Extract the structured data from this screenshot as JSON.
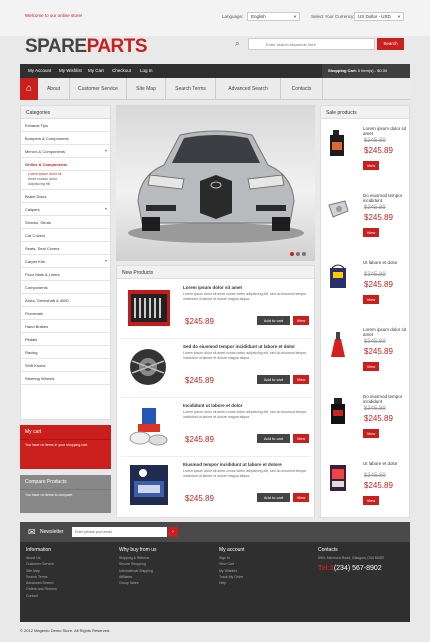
{
  "topbar": {
    "welcome": "Welcome to our online store!",
    "language_label": "Language:",
    "language_value": "English",
    "currency_label": "Select Your Currency:",
    "currency_value": "US Dollar - USD"
  },
  "logo": {
    "part1": "SPARE",
    "part2": "PARTS"
  },
  "search": {
    "placeholder": "Enter search keywords here",
    "button": "Search"
  },
  "utility": {
    "links": [
      "My Account",
      "My Wishlist",
      "My Cart",
      "Checkout",
      "Log In"
    ],
    "cart_label": "Shopping Cart:",
    "cart_value": "0 item(s) - $0.00"
  },
  "nav": {
    "items": [
      "About",
      "Customer Service",
      "Site Map",
      "Search Terms",
      "Advanced Search",
      "Contacts"
    ]
  },
  "categories": {
    "title": "Categories",
    "items": [
      "Exhaust Tips",
      "Bumpers & Components",
      "Mirrors & Components",
      "Grilles & Components",
      "Brake Discs",
      "Calipers",
      "Shocks, Struts",
      "Car Covers",
      "Seats, Seat Covers",
      "Carpet Kits",
      "Floor Mats & Liners",
      "Components",
      "Axles, Driveshaft & 4WD",
      "Floormats",
      "Hand Brakes",
      "Pedals",
      "Racing",
      "Shift Knobs",
      "Steering Wheels"
    ],
    "active_index": 3,
    "subitems": [
      "Lorem ipsum dolor sit",
      "Amet consec dolor",
      "Adipisicing elit"
    ],
    "sub_active_index": 0
  },
  "mycart": {
    "title": "My cart",
    "message": "You have no items in your shopping cart."
  },
  "compare": {
    "title": "Compare Products",
    "message": "You have no items to compare."
  },
  "new_products": {
    "title": "New Products",
    "items": [
      {
        "title": "Lorem ipsum dolor sit amet",
        "desc": "Lorem ipsum dolor sit amet conse ctetur adipisicing elit, sed do eiusmod tempor incididunt ut labore et dolore magna aliqua.",
        "price": "$245.89",
        "add": "Add to cart",
        "view": "View"
      },
      {
        "title": "Sed do eiusmod tempor incididunt ut labore et dolor",
        "desc": "Lorem ipsum dolor sit amet conse ctetur adipisicing elit, sed do eiusmod tempor incididunt ut labore et dolore magna aliqua.",
        "price": "$245.89",
        "add": "Add to cart",
        "view": "View"
      },
      {
        "title": "Incididunt ut labore et dolor",
        "desc": "Lorem ipsum dolor sit amet conse ctetur adipisicing elit, sed do eiusmod tempor incididunt ut labore et dolore magna aliqua.",
        "price": "$245.89",
        "add": "Add to cart",
        "view": "View"
      },
      {
        "title": "Eiusmod tempor incididunt ut labore et dolore",
        "desc": "Lorem ipsum dolor sit amet conse ctetur adipisicing elit, sed do eiusmod tempor incididunt ut labore et dolore magna aliqua.",
        "price": "$245.89",
        "add": "Add to cart",
        "view": "View"
      }
    ]
  },
  "sale_products": {
    "title": "Sale products",
    "items": [
      {
        "title": "Lorem ipsum dolor sit amet",
        "old": "$345.89",
        "new": "$245.89",
        "view": "View"
      },
      {
        "title": "Do eiusmod tempor incididunt",
        "old": "$345.89",
        "new": "$245.89",
        "view": "View"
      },
      {
        "title": "Ut labore et dolor",
        "old": "$345.89",
        "new": "$245.89",
        "view": "View"
      },
      {
        "title": "Lorem ipsum dolor sit amet",
        "old": "$345.89",
        "new": "$245.89",
        "view": "View"
      },
      {
        "title": "Do eiusmod tempor incididunt",
        "old": "$345.89",
        "new": "$245.89",
        "view": "View"
      },
      {
        "title": "Ut labore et dolor",
        "old": "$345.89",
        "new": "$245.89",
        "view": "View"
      }
    ]
  },
  "newsletter": {
    "label": "Newsletter",
    "placeholder": "Enter please your email"
  },
  "footer": {
    "information": {
      "title": "Information",
      "links": [
        "About Us",
        "Customer Service",
        "Site Map",
        "Search Terms",
        "Advanced Search",
        "Orders and Returns",
        "Contact"
      ]
    },
    "why": {
      "title": "Why buy from us",
      "links": [
        "Shipping & Returns",
        "Secure Shopping",
        "International Shipping",
        "Affiliates",
        "Group Sales"
      ]
    },
    "account": {
      "title": "My account",
      "links": [
        "Sign In",
        "View Cart",
        "My Wishlist",
        "Track My Order",
        "Help"
      ]
    },
    "contacts": {
      "title": "Contacts",
      "address": "8901 Marmora Road, Glasgow, D04 89GR",
      "phone_code": "Tel:1",
      "phone_rest": "(234) 567-8902"
    }
  },
  "copyright": "© 2012 Magento Demo Store. All Rights Reserved."
}
